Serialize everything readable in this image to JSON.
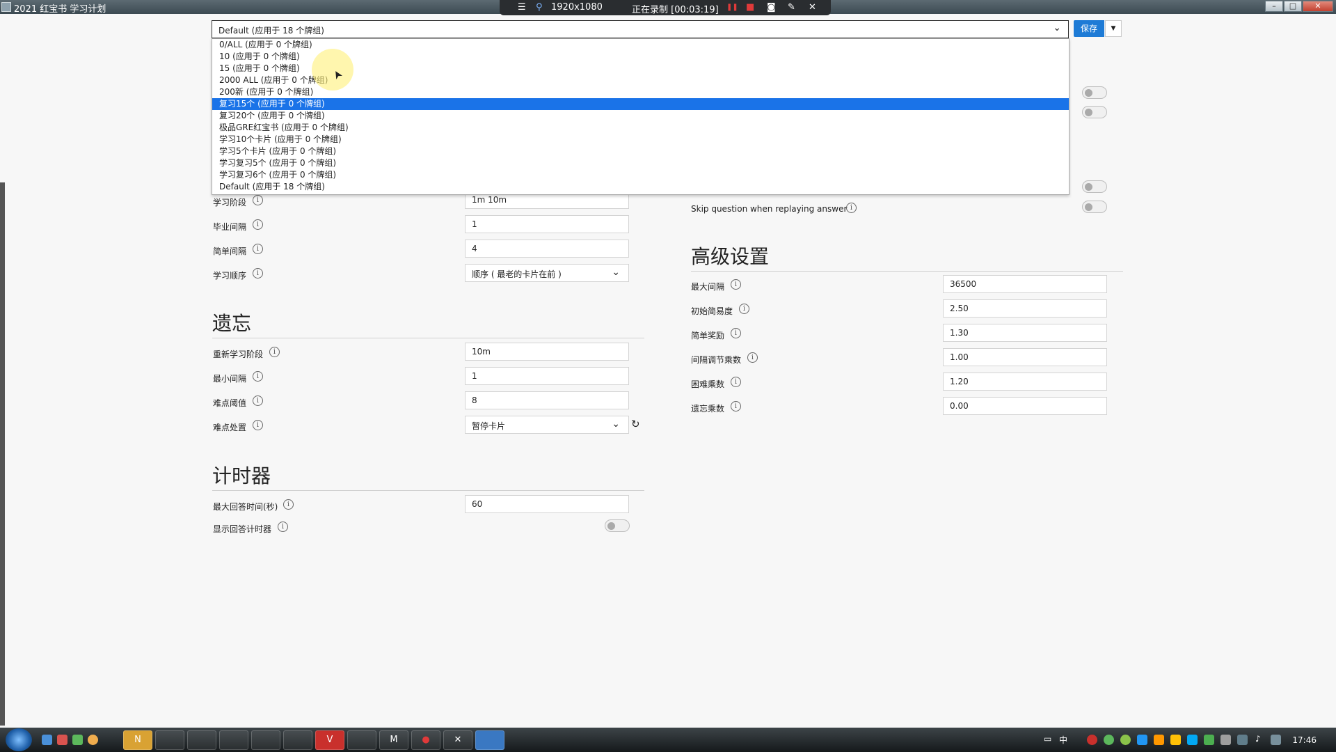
{
  "window": {
    "title": "2021 红宝书 学习计划",
    "minimize": "–",
    "maximize": "□",
    "close": "✕"
  },
  "recorder": {
    "resolution": "1920x1080",
    "status": "正在录制 [00:03:19]",
    "menu": "☰",
    "pin": "⚲",
    "pause": "❚❚",
    "stop": "■",
    "camera": "◙",
    "pen": "✎",
    "close": "✕"
  },
  "header": {
    "profile_value": "Default (应用于 18 个牌组)",
    "save_label": "保存",
    "save_menu": "▼"
  },
  "dropdown": {
    "options": [
      "0/ALL (应用于 0 个牌组)",
      "10 (应用于 0 个牌组)",
      "15 (应用于 0 个牌组)",
      "2000 ALL (应用于 0 个牌组)",
      "200新 (应用于 0 个牌组)",
      "复习15个 (应用于 0 个牌组)",
      "复习20个 (应用于 0 个牌组)",
      "极品GRE红宝书 (应用于 0 个牌组)",
      "学习10个卡片 (应用于 0 个牌组)",
      "学习5个卡片 (应用于 0 个牌组)",
      "学习复习5个 (应用于 0 个牌组)",
      "学习复习6个 (应用于 0 个牌组)",
      "Default (应用于 18 个牌组)"
    ],
    "selected_index": 5
  },
  "new_cards": {
    "learning_steps_label": "学习阶段",
    "learning_steps": "1m 10m",
    "graduating_label": "毕业间隔",
    "graduating": "1",
    "easy_label": "简单间隔",
    "easy": "4",
    "order_label": "学习顺序",
    "order": "顺序 ( 最老的卡片在前 )"
  },
  "lapses": {
    "title": "遗忘",
    "relearn_label": "重新学习阶段",
    "relearn": "10m",
    "min_interval_label": "最小间隔",
    "min_interval": "1",
    "leech_threshold_label": "难点阈值",
    "leech_threshold": "8",
    "leech_action_label": "难点处置",
    "leech_action": "暂停卡片"
  },
  "timer": {
    "title": "计时器",
    "max_answer_label": "最大回答时间(秒)",
    "max_answer": "60",
    "show_timer_label": "显示回答计时器"
  },
  "audio": {
    "skip_question_label": "Skip question when replaying answer"
  },
  "advanced": {
    "title": "高级设置",
    "max_interval_label": "最大间隔",
    "max_interval": "36500",
    "start_ease_label": "初始简易度",
    "start_ease": "2.50",
    "easy_bonus_label": "简单奖励",
    "easy_bonus": "1.30",
    "interval_modifier_label": "间隔调节乘数",
    "interval_modifier": "1.00",
    "hard_multiplier_label": "困难乘数",
    "hard_multiplier": "1.20",
    "lapse_multiplier_label": "遗忘乘数",
    "lapse_multiplier": "0.00"
  },
  "icons": {
    "info": "i",
    "chevron": "⌄",
    "reset": "↻",
    "cursor": "➤"
  },
  "taskbar": {
    "clock": "17:46",
    "ime": "中",
    "items": [
      "N",
      "",
      "",
      "",
      "",
      "",
      "V",
      "",
      "M",
      "●",
      "✕",
      ""
    ]
  }
}
